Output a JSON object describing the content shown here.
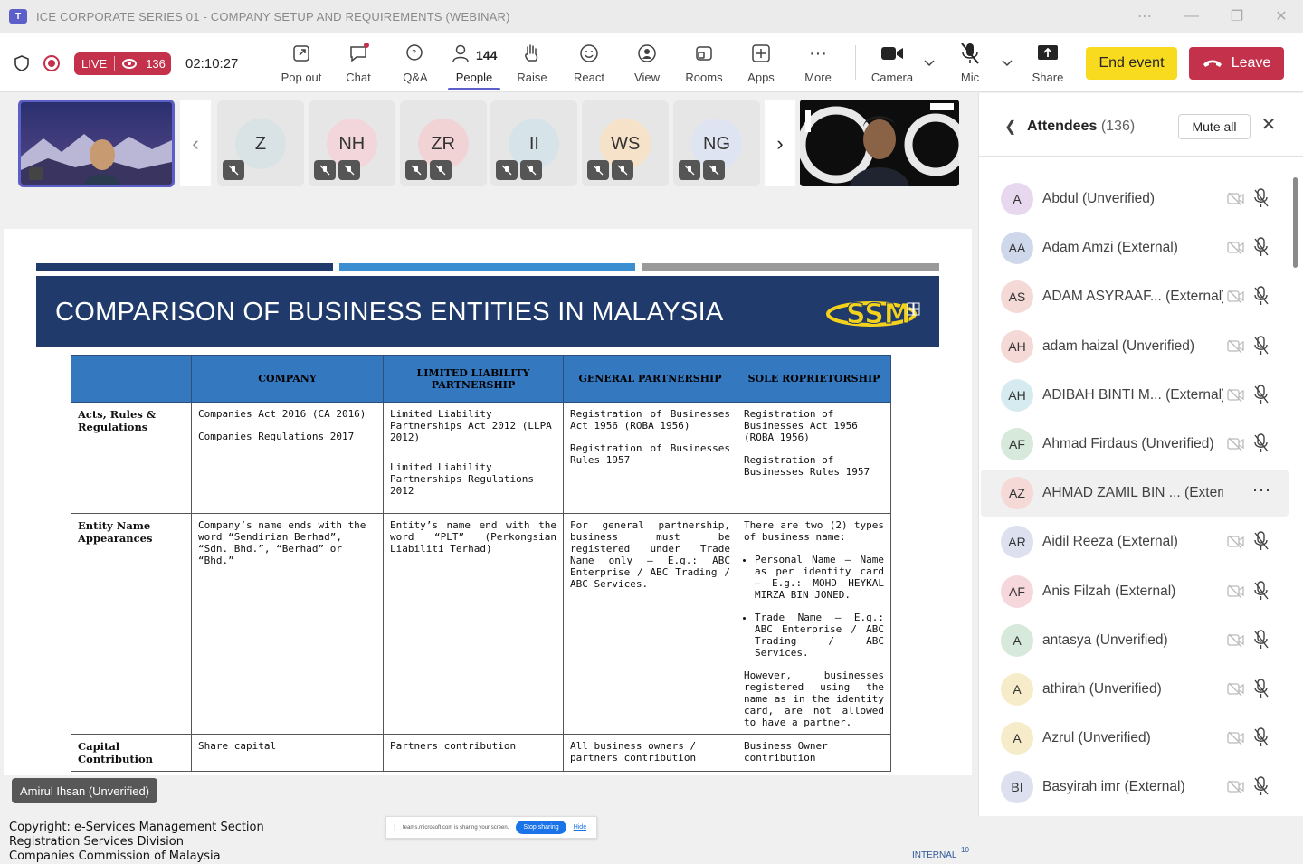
{
  "window": {
    "title": "ICE CORPORATE SERIES 01 - COMPANY SETUP AND REQUIREMENTS (WEBINAR)",
    "app_badge": "T"
  },
  "toolbar": {
    "live": "LIVE",
    "viewers": "136",
    "elapsed": "02:10:27",
    "people_count": "144",
    "buttons": {
      "popout": "Pop out",
      "chat": "Chat",
      "qa": "Q&A",
      "people": "People",
      "raise": "Raise",
      "react": "React",
      "view": "View",
      "rooms": "Rooms",
      "apps": "Apps",
      "more": "More",
      "camera": "Camera",
      "mic": "Mic",
      "share": "Share"
    },
    "end_event": "End event",
    "leave": "Leave"
  },
  "gallery": {
    "tiles": [
      {
        "initials": "Z",
        "color": "#d9e3e6"
      },
      {
        "initials": "NH",
        "color": "#f3d6dc"
      },
      {
        "initials": "ZR",
        "color": "#f1d3d6"
      },
      {
        "initials": "II",
        "color": "#d6e4ea"
      },
      {
        "initials": "WS",
        "color": "#f6e2c8"
      },
      {
        "initials": "NG",
        "color": "#dfe4f2"
      }
    ]
  },
  "slide": {
    "title": "COMPARISON OF BUSINESS ENTITIES IN MALAYSIA",
    "logo": "SSM",
    "headers": [
      "COMPANY",
      "LIMITED LIABILITY PARTNERSHIP",
      "GENERAL PARTNERSHIP",
      "SOLE ROPRIETORSHIP"
    ],
    "rows": {
      "acts": {
        "label": "Acts, Rules & Regulations",
        "company_1": "Companies Act 2016 (CA 2016)",
        "company_2": "Companies Regulations 2017",
        "llp_1": "Limited Liability Partnerships Act 2012 (LLPA 2012)",
        "llp_2": "Limited Liability Partnerships Regulations 2012",
        "gp_1": "Registration of Businesses Act 1956 (ROBA 1956)",
        "gp_2": "Registration of Businesses Rules 1957",
        "sp_1": "Registration of Businesses Act 1956 (ROBA 1956)",
        "sp_2": "Registration of Businesses Rules 1957"
      },
      "name": {
        "label": "Entity Name Appearances",
        "company": "Company’s name ends with the word “Sendirian Berhad”, “Sdn. Bhd.”, “Berhad” or “Bhd.”",
        "llp": "Entity’s name end with the word “PLT” (Perkongsian Liabiliti Terhad)",
        "gp": "For general partnership, business must be registered under Trade Name only – E.g.: ABC Enterprise / ABC Trading / ABC Services.",
        "sp_intro": "There are two (2) types of business name:",
        "sp_b1": "Personal Name – Name as per identity card – E.g.: MOHD HEYKAL MIRZA BIN JONED.",
        "sp_b2": "Trade Name – E.g.: ABC Enterprise / ABC Trading / ABC Services.",
        "sp_note": "However, businesses registered using the name as in the identity card, are not allowed to have a partner."
      },
      "capital": {
        "label": "Capital Contribution",
        "company": "Share capital",
        "llp": "Partners contribution",
        "gp": "All business owners / partners contribution",
        "sp": "Business Owner contribution"
      }
    },
    "copyright_1": "Copyright: e-Services Management Section",
    "copyright_2": "Registration Services Division",
    "copyright_3": "Companies Commission of Malaysia",
    "internal": "INTERNAL",
    "page": "10",
    "sharing_notice": "teams.microsoft.com is sharing your screen.",
    "stop_sharing": "Stop sharing",
    "hide": "Hide"
  },
  "presenter_name": "Amirul Ihsan (Unverified)",
  "attendees_panel": {
    "title": "Attendees",
    "count": "(136)",
    "mute_all": "Mute all",
    "list": [
      {
        "initials": "A",
        "name": "Abdul",
        "tag": "(Unverified)",
        "color": "#e8d8ef"
      },
      {
        "initials": "AA",
        "name": "Adam Amzi",
        "tag": "(External)",
        "color": "#cfd8ea"
      },
      {
        "initials": "AS",
        "name": "ADAM ASYRAAF...",
        "tag": "(External)",
        "color": "#f4d9d6"
      },
      {
        "initials": "AH",
        "name": "adam haizal",
        "tag": "(Unverified)",
        "color": "#f4d9d6"
      },
      {
        "initials": "AH",
        "name": "ADIBAH BINTI M...",
        "tag": "(External)",
        "color": "#d6ebf0"
      },
      {
        "initials": "AF",
        "name": "Ahmad Firdaus",
        "tag": "(Unverified)",
        "color": "#d6e9da"
      },
      {
        "initials": "AZ",
        "name": "AHMAD ZAMIL BIN ...",
        "tag": "(External)",
        "color": "#f4d9d6"
      },
      {
        "initials": "AR",
        "name": "Aidil Reeza",
        "tag": "(External)",
        "color": "#dde1ef"
      },
      {
        "initials": "AF",
        "name": "Anis Filzah",
        "tag": "(External)",
        "color": "#f6d7dc"
      },
      {
        "initials": "A",
        "name": "antasya",
        "tag": "(Unverified)",
        "color": "#d6e9da"
      },
      {
        "initials": "A",
        "name": "athirah",
        "tag": "(Unverified)",
        "color": "#f6ecc9"
      },
      {
        "initials": "A",
        "name": "Azrul",
        "tag": "(Unverified)",
        "color": "#f6ecc9"
      },
      {
        "initials": "BI",
        "name": "Basyirah imr",
        "tag": "(External)",
        "color": "#dde1ef"
      }
    ]
  },
  "colors": {
    "accent": "#5b5fc7",
    "live": "#c4314b",
    "end_event": "#f8da1f",
    "leave": "#c4314b",
    "slide_banner": "#1f3a6b",
    "table_header": "#3478c0"
  }
}
